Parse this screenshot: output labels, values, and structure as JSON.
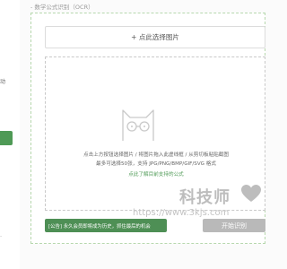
{
  "sidebar": {
    "partial_label": "动",
    "dash": "-"
  },
  "section": {
    "title": "- 数学公式识别（OCR）"
  },
  "upload": {
    "button_label": "+ 点此选择图片"
  },
  "dropzone": {
    "icon": "cat-glasses-icon",
    "hint_line1": "点击上方按钮选择图片 / 将图片拖入此虚线框 / 从剪切板粘贴截图",
    "hint_line2": "最多可选择50张，支持 JPG/PNG/BMP/GIF/SVG 格式",
    "formula_link": "点此了解目前支持的公式"
  },
  "watermark": {
    "brand": "科技师",
    "url": "https://www.3kjs.com",
    "heart_icon": "heart-icon"
  },
  "footer": {
    "notice": "[公告] 永久会员即将成为历史，抓住最后的机会",
    "start_button": "开始识别"
  },
  "colors": {
    "accent": "#4f9a56",
    "notice_bg": "#4e8f55",
    "disabled_button": "#b9b9b9"
  }
}
